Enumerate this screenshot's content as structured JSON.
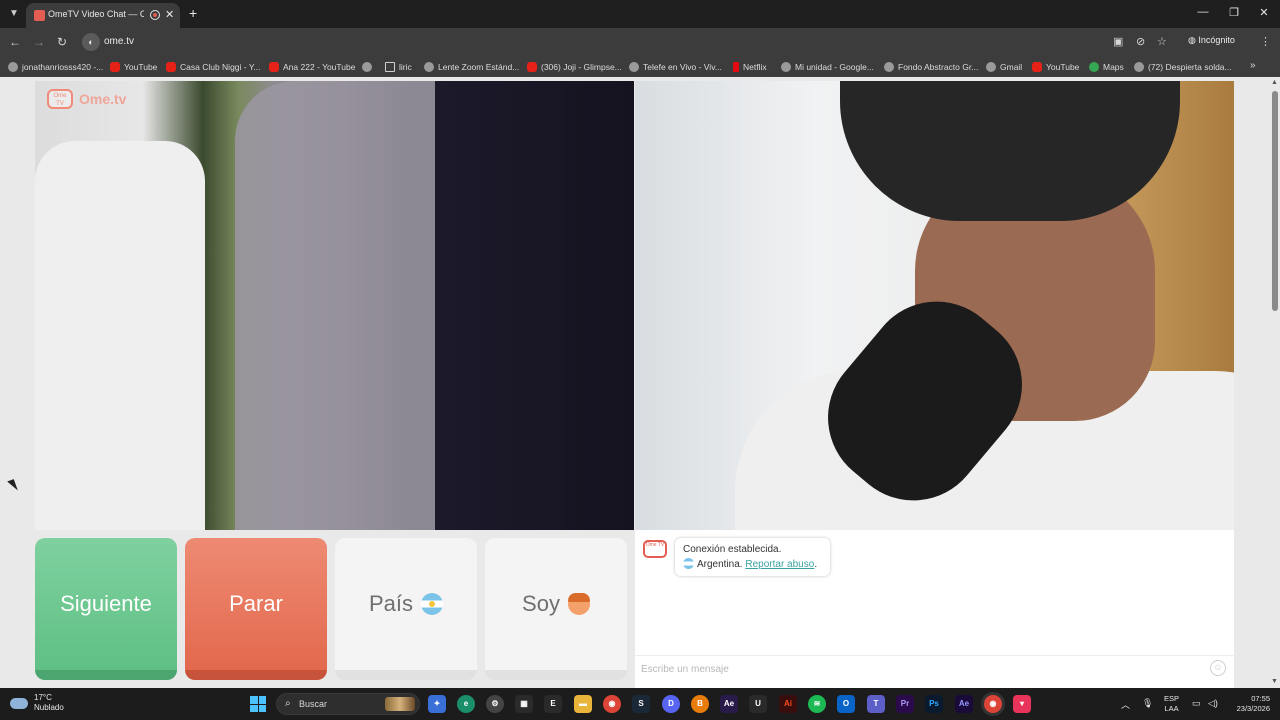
{
  "browser": {
    "tab_title": "OmeTV Video Chat — Ome",
    "url": "ome.tv",
    "incognito_label": "Incógnito",
    "bookmarks": [
      "jonathanriosss420 -...",
      "YouTube",
      "Casa Club Niggi - Y...",
      "Ana 222 - YouTube",
      "",
      "liric",
      "Lente Zoom Estánd...",
      "(306) Joji - Glimpse...",
      "Telefe en Vivo - Viv...",
      "Netflix",
      "Mi unidad - Google...",
      "Fondo Abstracto Gr...",
      "Gmail",
      "YouTube",
      "Maps",
      "(72) Despierta solda..."
    ]
  },
  "page": {
    "logo_text": "Ome.tv",
    "logo_badge": "Ome TV",
    "buttons": {
      "next": "Siguiente",
      "stop": "Parar",
      "country": "País",
      "gender": "Soy"
    },
    "chat": {
      "status": "Conexión establecida.",
      "country": "Argentina.",
      "report_link": "Reportar abuso",
      "report_tail": ".",
      "input_placeholder": "Escribe un mensaje"
    }
  },
  "taskbar": {
    "weather_temp": "17°C",
    "weather_desc": "Nublado",
    "search_label": "Buscar",
    "lang_top": "ESP",
    "lang_bottom": "LAA",
    "time": "07:55",
    "date": "23/3/2026"
  },
  "colors": {
    "next_button": "#5fc084",
    "stop_button": "#e2694e",
    "neutral_button": "#f4f4f4",
    "report_link": "#3aa3a0",
    "ome_red": "#e35d52"
  }
}
